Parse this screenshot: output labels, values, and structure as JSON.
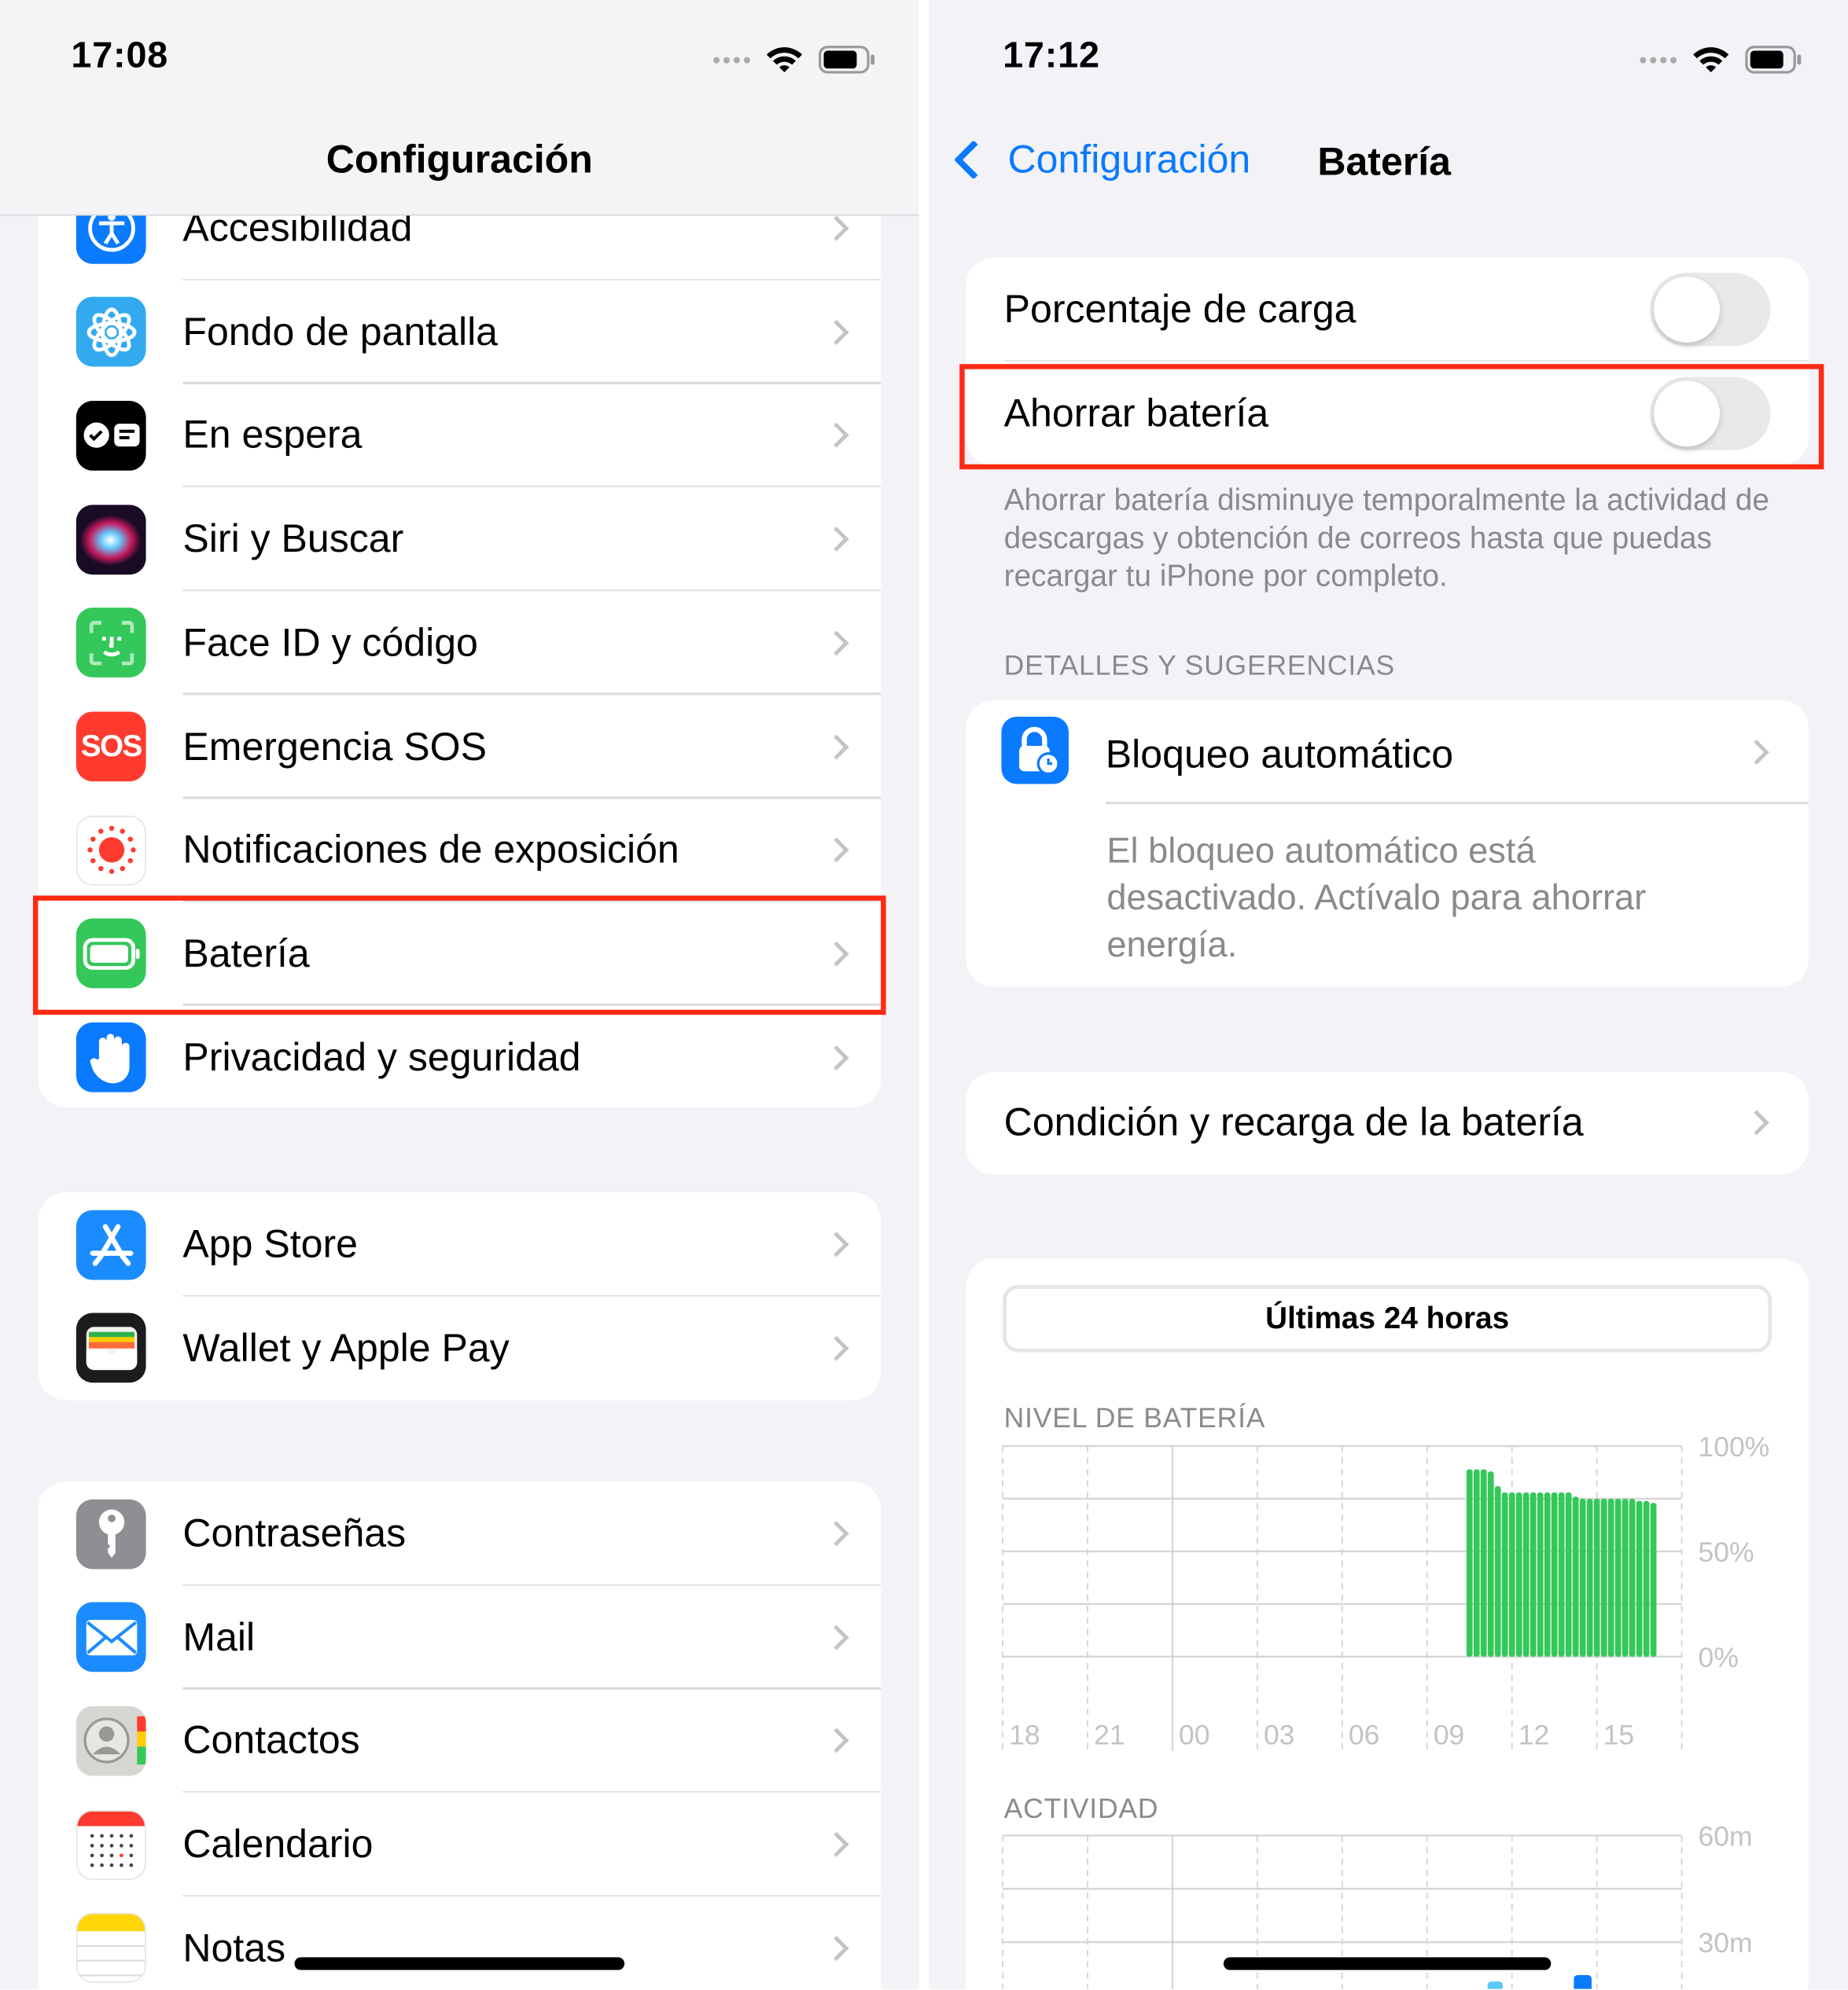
{
  "left": {
    "status_time": "17:08",
    "title": "Configuración",
    "groups": [
      [
        {
          "label": "Accesibilidad",
          "icon": "accessibility-icon",
          "color": "#0a7aff"
        },
        {
          "label": "Fondo de pantalla",
          "icon": "wallpaper-flower-icon",
          "color": "#33aaf0"
        },
        {
          "label": "En espera",
          "icon": "standby-icon",
          "color": "#000000"
        },
        {
          "label": "Siri y Buscar",
          "icon": "siri-icon",
          "color": "#2a1030"
        },
        {
          "label": "Face ID y código",
          "icon": "face-id-icon",
          "color": "#34c759"
        },
        {
          "label": "Emergencia SOS",
          "icon": "sos-icon",
          "color": "#ff3b30",
          "icon_text": "SOS"
        },
        {
          "label": "Notificaciones de exposición",
          "icon": "exposure-icon",
          "color": "#ffffff"
        },
        {
          "label": "Batería",
          "icon": "battery-icon",
          "color": "#34c759"
        },
        {
          "label": "Privacidad y seguridad",
          "icon": "hand-icon",
          "color": "#0a7aff"
        }
      ],
      [
        {
          "label": "App Store",
          "icon": "app-store-icon",
          "color": "#1a8cff"
        },
        {
          "label": "Wallet y Apple Pay",
          "icon": "wallet-icon",
          "color": "#1c1c1e"
        }
      ],
      [
        {
          "label": "Contraseñas",
          "icon": "key-icon",
          "color": "#8e8e93"
        },
        {
          "label": "Mail",
          "icon": "mail-icon",
          "color": "#1a8cff"
        },
        {
          "label": "Contactos",
          "icon": "contacts-icon",
          "color": "#d8d6d2"
        },
        {
          "label": "Calendario",
          "icon": "calendar-icon",
          "color": "#ffffff"
        },
        {
          "label": "Notas",
          "icon": "notes-icon",
          "color": "#ffffff"
        }
      ]
    ]
  },
  "right": {
    "status_time": "17:12",
    "back_label": "Configuración",
    "title": "Batería",
    "accent": "#0a7aff",
    "toggles": [
      {
        "label": "Porcentaje de carga",
        "on": false
      },
      {
        "label": "Ahorrar batería",
        "on": false
      }
    ],
    "low_power_footer": "Ahorrar batería disminuye temporalmente la actividad de descargas y obtención de correos hasta que puedas recargar tu iPhone por completo.",
    "section_header": "DETALLES Y SUGERENCIAS",
    "suggestion": {
      "label": "Bloqueo automático",
      "description": "El bloqueo automático está desactivado. Actívalo para ahorrar energía."
    },
    "health_label": "Condición y recarga de la batería",
    "range_button": "Últimas 24 horas",
    "battery_level_header": "NIVEL DE BATERÍA",
    "activity_header": "ACTIVIDAD"
  },
  "chart_data": [
    {
      "type": "bar",
      "title": "NIVEL DE BATERÍA",
      "x_ticks": [
        "18",
        "21",
        "00",
        "03",
        "06",
        "09",
        "12",
        "15"
      ],
      "y_ticks": [
        "100%",
        "50%",
        "0%"
      ],
      "ylim": [
        0,
        100
      ],
      "grid": true,
      "color": "#34c759",
      "x": [
        "10:30",
        "10:45",
        "11:00",
        "11:15",
        "11:30",
        "11:45",
        "12:00",
        "12:15",
        "12:30",
        "12:45",
        "13:00",
        "13:15",
        "13:30",
        "13:45",
        "14:00",
        "14:15",
        "14:30",
        "14:45",
        "15:00",
        "15:15",
        "15:30",
        "15:45",
        "16:00",
        "16:15",
        "16:30",
        "16:45",
        "17:00"
      ],
      "values": [
        89,
        89,
        89,
        88,
        81,
        78,
        78,
        78,
        78,
        78,
        78,
        78,
        78,
        78,
        78,
        76,
        75,
        75,
        75,
        75,
        75,
        75,
        75,
        75,
        74,
        74,
        73
      ]
    },
    {
      "type": "bar",
      "title": "ACTIVIDAD",
      "x_ticks": [
        "18",
        "21",
        "00",
        "03",
        "06",
        "09",
        "12",
        "15"
      ],
      "y_ticks": [
        "60m",
        "30m"
      ],
      "grid": true
    }
  ]
}
